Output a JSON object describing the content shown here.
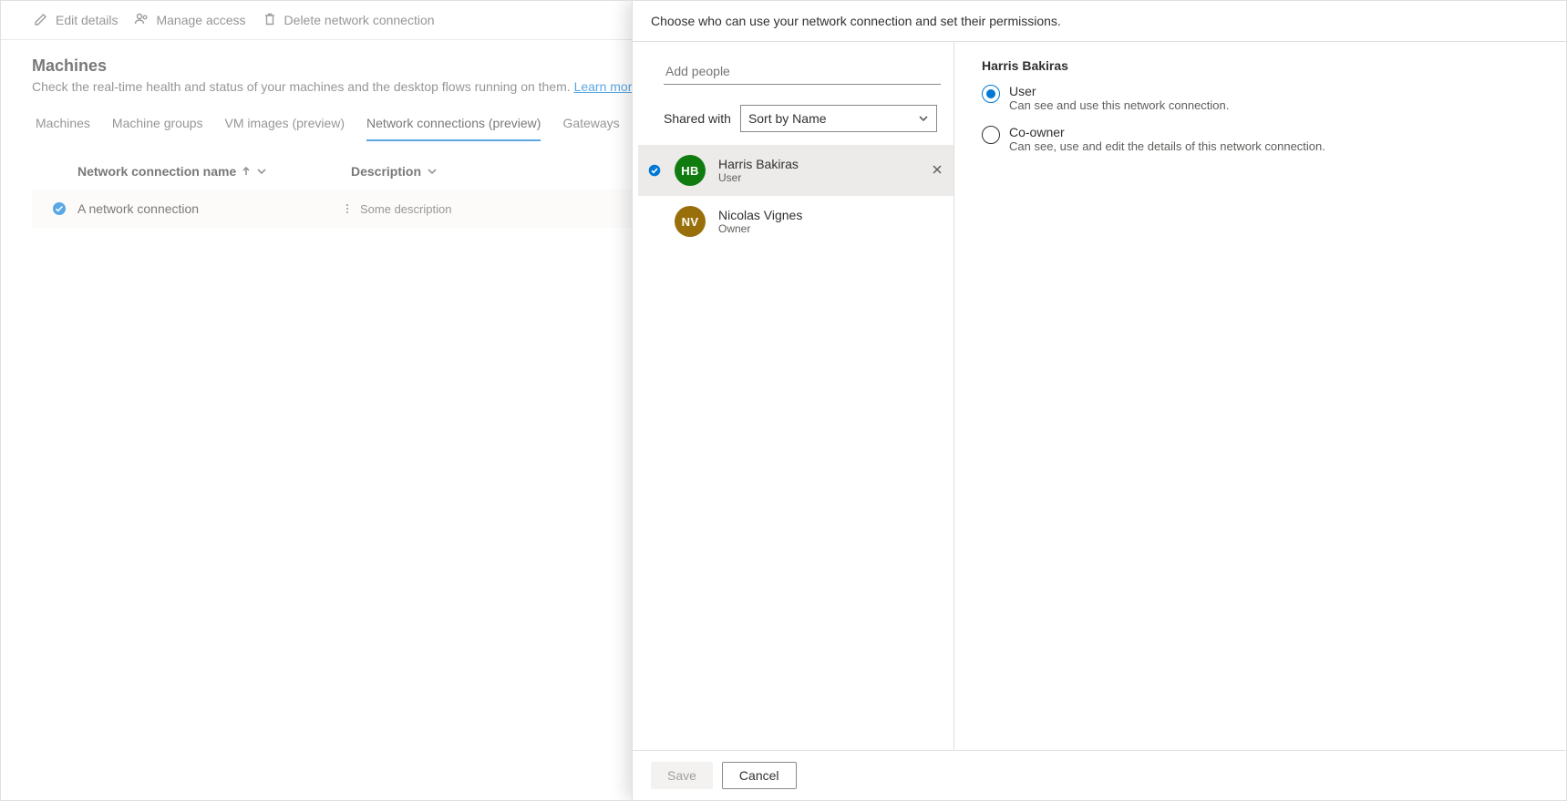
{
  "commands": {
    "edit": "Edit details",
    "access": "Manage access",
    "delete": "Delete network connection"
  },
  "page": {
    "title": "Machines",
    "desc": "Check the real-time health and status of your machines and the desktop flows running on them.",
    "learn_more": "Learn more"
  },
  "tabs": {
    "machines": "Machines",
    "groups": "Machine groups",
    "vmimages": "VM images (preview)",
    "netconn": "Network connections (preview)",
    "gateways": "Gateways"
  },
  "grid": {
    "col_name": "Network connection name",
    "col_desc": "Description",
    "row": {
      "name": "A network connection",
      "desc": "Some description"
    }
  },
  "panel": {
    "header": "Choose who can use your network connection and set their permissions.",
    "add_placeholder": "Add people",
    "shared_with_label": "Shared with",
    "sort_label": "Sort by Name",
    "people": [
      {
        "initials": "HB",
        "name": "Harris Bakiras",
        "role": "User",
        "avatar": "green",
        "selected": true,
        "removable": true
      },
      {
        "initials": "NV",
        "name": "Nicolas Vignes",
        "role": "Owner",
        "avatar": "olive",
        "selected": false,
        "removable": false
      }
    ],
    "perm_title": "Harris Bakiras",
    "perms": {
      "user": {
        "label": "User",
        "desc": "Can see and use this network connection."
      },
      "co": {
        "label": "Co-owner",
        "desc": "Can see, use and edit the details of this network connection."
      }
    },
    "buttons": {
      "save": "Save",
      "cancel": "Cancel"
    }
  }
}
